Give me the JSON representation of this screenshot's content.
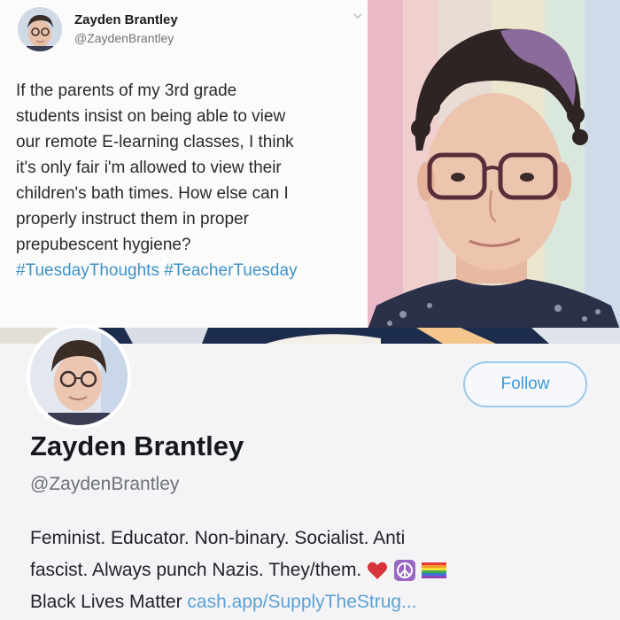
{
  "tweet": {
    "author_name": "Zayden Brantley",
    "author_handle": "@ZaydenBrantley",
    "lines": [
      "If the parents of my 3rd grade",
      "students insist on being able to view",
      "our remote E-learning classes, I think",
      "it's only fair i'm allowed to view their",
      "children's bath times. How else can I",
      "properly instruct them in proper",
      "prepubescent hygiene?"
    ],
    "hashtags": "#TuesdayThoughts #TeacherTuesday"
  },
  "profile": {
    "follow_label": "Follow",
    "name": "Zayden Brantley",
    "handle": "@ZaydenBrantley",
    "bio_line1": "Feminist. Educator. Non-binary. Socialist. Anti",
    "bio_line2": "fascist. Always punch Nazis. They/them.",
    "bio_line3_text": "Black Lives Matter",
    "bio_link": "cash.app/SupplyTheStrug..."
  },
  "icons": {
    "heart": "heart-icon",
    "peace": "peace-sign-icon",
    "flag": "rainbow-flag-icon",
    "chevron": "chevron-down-icon"
  },
  "colors": {
    "link": "#3d93c9",
    "follow_border": "#9dc9e8"
  }
}
